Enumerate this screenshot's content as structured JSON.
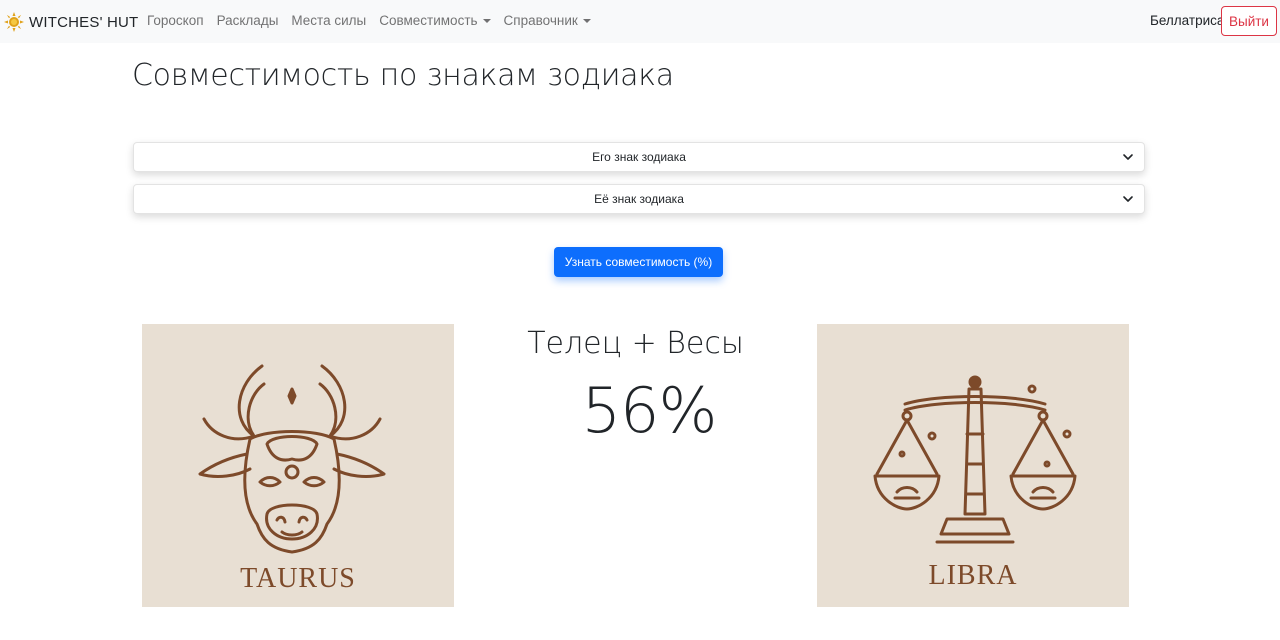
{
  "navbar": {
    "brand": "WITCHES' HUT",
    "links": [
      {
        "label": "Гороскоп",
        "dropdown": false
      },
      {
        "label": "Расклады",
        "dropdown": false
      },
      {
        "label": "Места силы",
        "dropdown": false
      },
      {
        "label": "Совместимость",
        "dropdown": true
      },
      {
        "label": "Справочник",
        "dropdown": true
      }
    ],
    "user_name": "Беллатриса",
    "logout_label": "Выйти"
  },
  "page": {
    "title": "Совместимость по знакам зодиака",
    "his_sign_placeholder": "Его знак зодиака",
    "her_sign_placeholder": "Её знак зодиака",
    "submit_label": "Узнать совместимость (%)"
  },
  "result": {
    "pair": "Телец + Весы",
    "percent": "56%",
    "left_sign_label": "TAURUS",
    "right_sign_label": "LIBRA"
  },
  "colors": {
    "accent": "#0d6efd",
    "danger": "#dc3545",
    "card_bg": "#e8dfd3",
    "illustration": "#7d4a2a"
  }
}
